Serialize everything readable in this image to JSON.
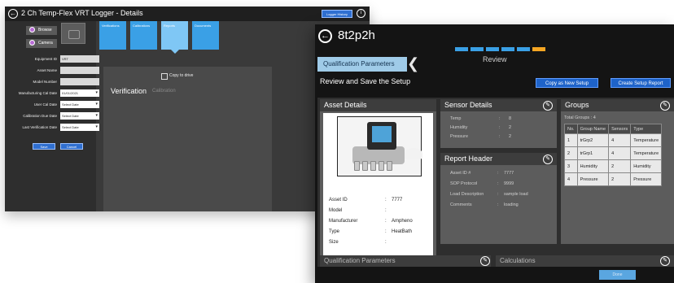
{
  "win1": {
    "title": "2 Ch Temp-Flex VRT Logger - Details",
    "logger_history": "Logger History",
    "info_glyph": "i",
    "back_glyph": "←",
    "browse": "Browse",
    "camera": "Camera",
    "fields": [
      {
        "label": "Equipment ID",
        "value": "VRT"
      },
      {
        "label": "Asset Name",
        "value": ""
      },
      {
        "label": "Model Number",
        "value": ""
      },
      {
        "label": "Manufacturing Cal Date",
        "value": "01/01/2021"
      },
      {
        "label": "User Cal Date",
        "value": "Select Date"
      },
      {
        "label": "Calibration Due Date",
        "value": "Select Date"
      },
      {
        "label": "Last Verification Date",
        "value": "Select Date"
      }
    ],
    "save": "Save",
    "cancel": "Cancel",
    "tiles": [
      "Verifications",
      "Calibrations",
      "Reports",
      "Documents"
    ],
    "copy_to_drive": "Copy to drive",
    "verification": "Verification",
    "calibration": "Calibration"
  },
  "win2": {
    "back_glyph": "←",
    "title": "8t2p2h",
    "qp_tab": "Qualification Parameters",
    "review": "Review",
    "subtitle": "Review and Save the Setup",
    "copy_setup": "Copy as New Setup",
    "create_report": "Create Setup Report",
    "asset_details": {
      "title": "Asset Details",
      "rows": [
        {
          "k": "Asset ID",
          "v": "7777"
        },
        {
          "k": "Model",
          "v": ""
        },
        {
          "k": "Manufacturer",
          "v": "Ampheno"
        },
        {
          "k": "Type",
          "v": "HeatBath"
        },
        {
          "k": "Size",
          "v": ""
        }
      ]
    },
    "sensor_details": {
      "title": "Sensor Details",
      "rows": [
        {
          "k": "Temp",
          "v": "8"
        },
        {
          "k": "Humidity",
          "v": "2"
        },
        {
          "k": "Pressure",
          "v": "2"
        }
      ]
    },
    "report_header": {
      "title": "Report Header",
      "rows": [
        {
          "k": "Asset ID #",
          "v": "7777"
        },
        {
          "k": "SOP Protocol",
          "v": "9999"
        },
        {
          "k": "Load Description",
          "v": "sample load"
        },
        {
          "k": "Comments",
          "v": "loading"
        }
      ]
    },
    "groups": {
      "title": "Groups",
      "total": "Total Groups : 4",
      "columns": [
        "No.",
        "Group Name",
        "Sensors",
        "Type"
      ],
      "rows": [
        [
          "1",
          "trGrp2",
          "4",
          "Temperature"
        ],
        [
          "2",
          "trGrp1",
          "4",
          "Temperature"
        ],
        [
          "3",
          "Humidity",
          "2",
          "Humidity"
        ],
        [
          "4",
          "Pressure",
          "2",
          "Pressure"
        ]
      ]
    },
    "bottom_left": "Qualification Parameters",
    "bottom_right": "Calculations",
    "done": "Done",
    "edit_glyph": "✎"
  }
}
